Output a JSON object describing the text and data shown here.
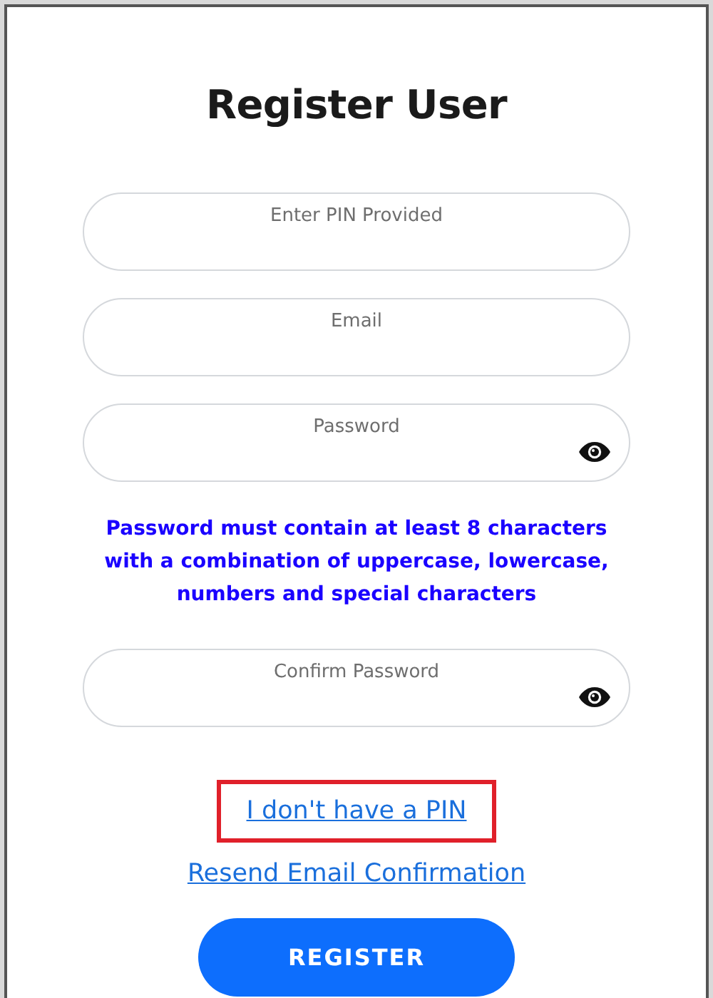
{
  "title": "Register User",
  "fields": [
    {
      "label": "Enter PIN Provided",
      "kind": "text"
    },
    {
      "label": "Email",
      "kind": "text"
    },
    {
      "label": "Password",
      "kind": "secret"
    }
  ],
  "hint": "Password must contain at least 8 characters with a combination of uppercase, lowercase, numbers and special characters",
  "confirm_field": {
    "label": "Confirm Password",
    "kind": "secret"
  },
  "links": [
    {
      "text": "I don't have a PIN",
      "highlighted": true
    },
    {
      "text": "Resend Email Confirmation",
      "highlighted": false
    }
  ],
  "button": "REGISTER"
}
